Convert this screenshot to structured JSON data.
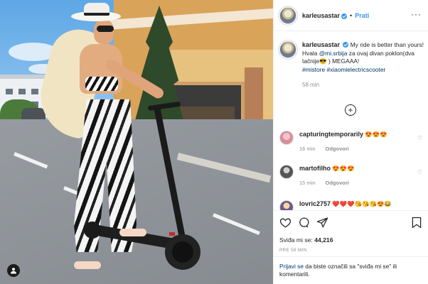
{
  "header": {
    "username": "karleusastar",
    "separator": "•",
    "follow_label": "Prati",
    "more_label": "···"
  },
  "caption": {
    "username": "karleusastar",
    "text_1": "My ride is better than yours!",
    "text_2": "Hvala ",
    "mention": "@mi.srbija",
    "text_3": " za ovaj divan poklon(dva tačnije😎 ) MEGAAA!",
    "hashtag_1": "#mistore",
    "hashtag_2": "#xiaomielectricscooter",
    "time": "58 min"
  },
  "load_more_label": "+",
  "comments": [
    {
      "username": "capturingtemporarily",
      "text": "😍😍😍",
      "time": "16 min",
      "reply_label": "Odgovori"
    },
    {
      "username": "martofilho",
      "text": "😍😍😍",
      "time": "15 min",
      "reply_label": "Odgovori"
    },
    {
      "username": "lovric2757",
      "text": "❤️❤️❤️😘😘😘😍😂"
    }
  ],
  "actions": {
    "likes_label": "Sviđa mi se: ",
    "likes_count": "44,216",
    "posted_ago": "PRE 58 MIN"
  },
  "login": {
    "link": "Prijavi se",
    "text": " da biste označili sa \"sviđa mi se\" ili komentarili."
  },
  "icons": {
    "like": "heart-icon",
    "comment": "comment-icon",
    "share": "share-icon",
    "save": "bookmark-icon",
    "user_tag": "user-tag-icon",
    "verified": "verified-badge-icon"
  },
  "colors": {
    "link_blue": "#3897f0",
    "dark_link": "#003569",
    "meta_grey": "#8e8e8e",
    "border": "#efefef"
  }
}
